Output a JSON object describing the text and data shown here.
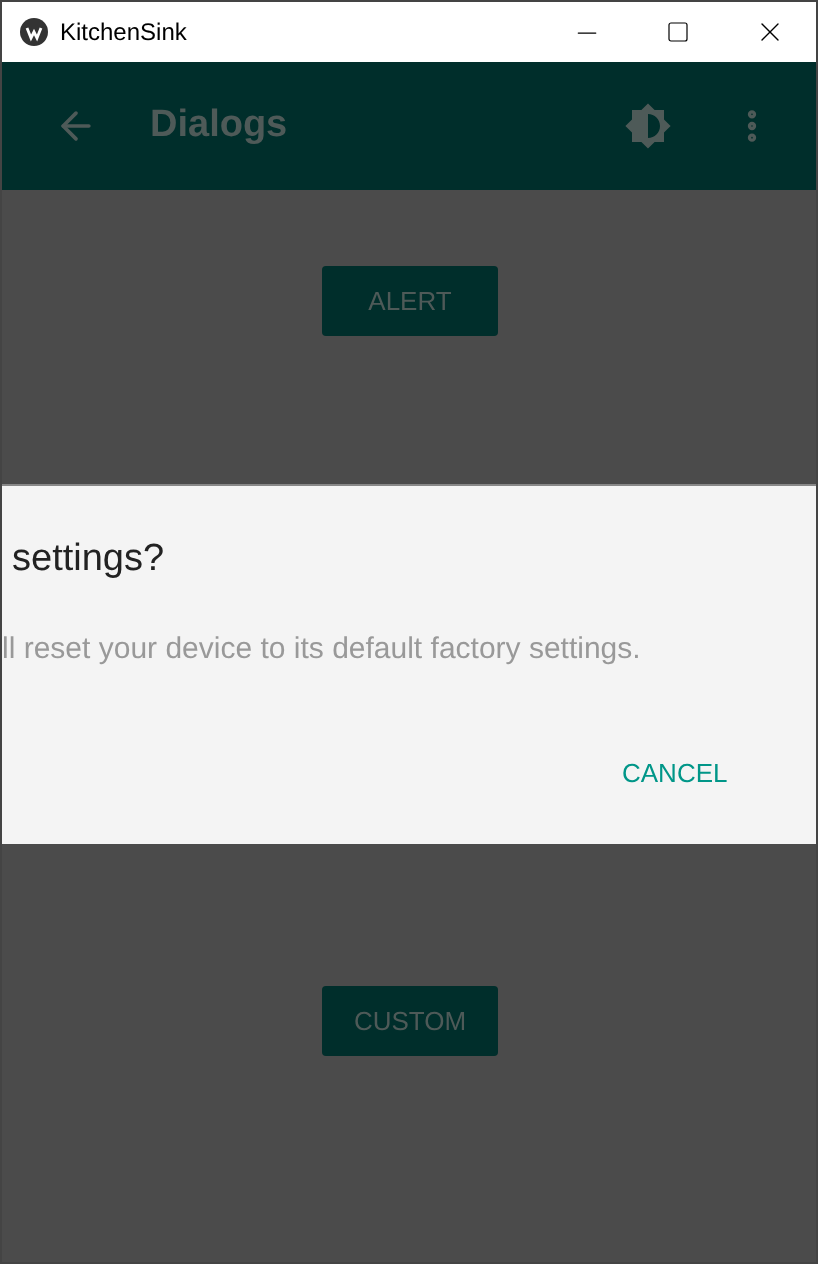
{
  "window": {
    "title": "KitchenSink"
  },
  "app_bar": {
    "title": "Dialogs"
  },
  "buttons": [
    {
      "label": "ALERT"
    },
    {
      "label": "CUSTOM"
    }
  ],
  "dialog": {
    "title": "settings?",
    "message": "ll reset your device to its default factory settings.",
    "actions": [
      {
        "label": "CANCEL"
      }
    ]
  }
}
